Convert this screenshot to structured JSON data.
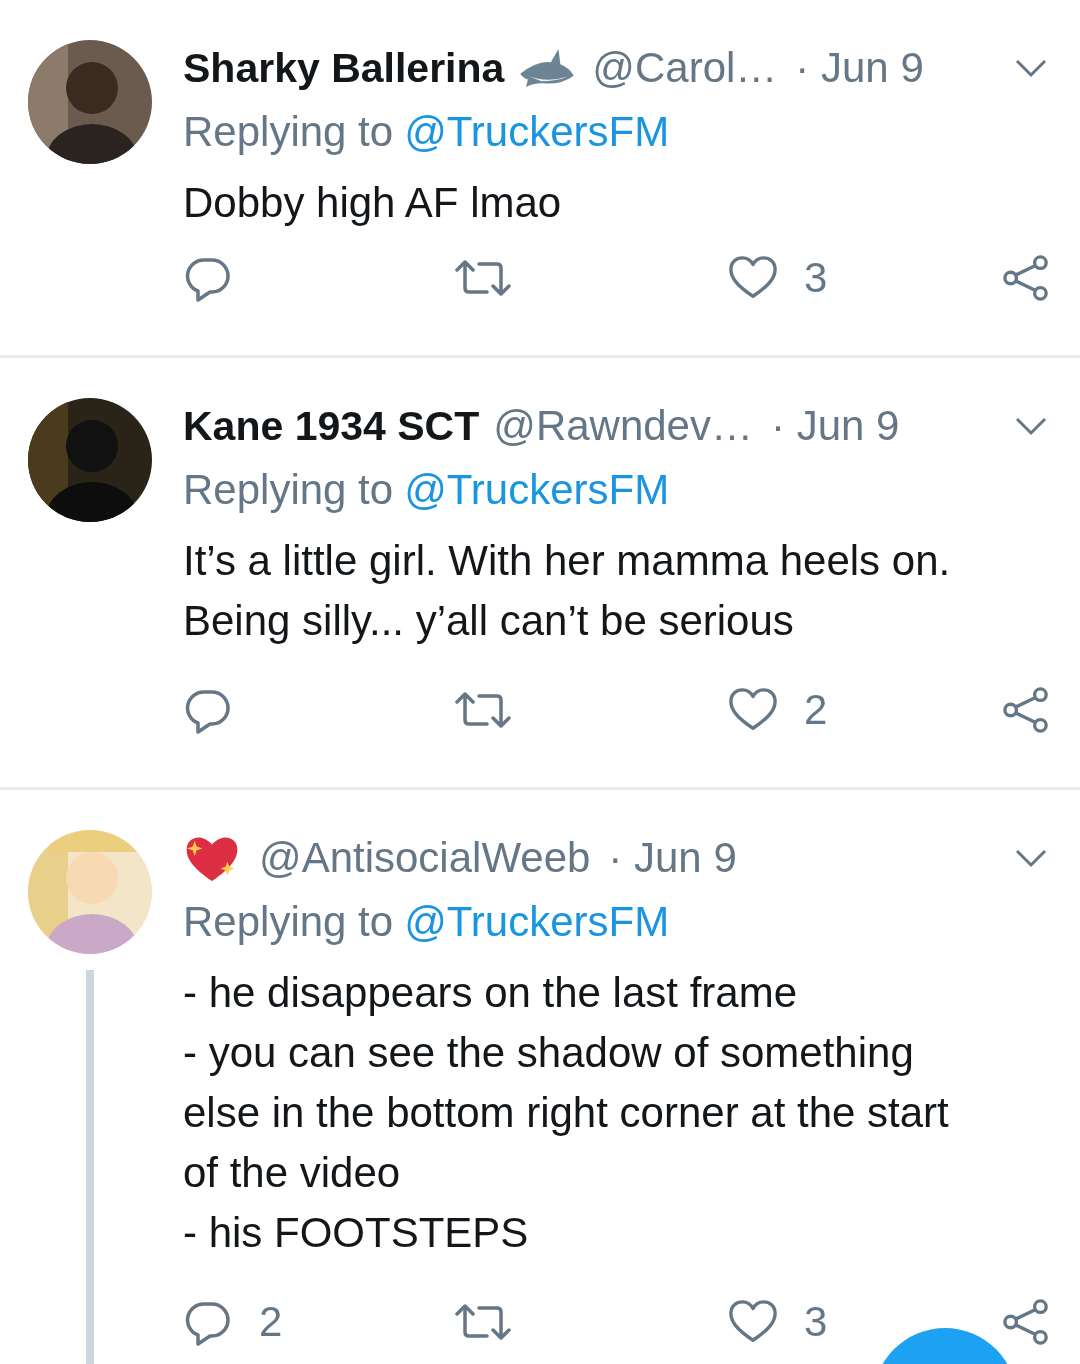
{
  "tweets": [
    {
      "name": "Sharky Ballerina",
      "badge": {
        "kind": "shark"
      },
      "handle": "@Carol…",
      "date": "· Jun 9",
      "reply_label": "Replying to",
      "reply_to": "@TruckersFM",
      "text": "Dobby high AF lmao",
      "likes": "3",
      "thread": false
    },
    {
      "name": "Kane 1934 SCT",
      "handle": "@Rawndev…",
      "date": "· Jun 9",
      "reply_label": "Replying to",
      "reply_to": "@TruckersFM",
      "text": "It’s a little girl. With her mamma heels on.\nBeing silly... y’all can’t be serious",
      "likes": "2",
      "thread": false
    },
    {
      "badge": {
        "kind": "heart"
      },
      "handle": "@AntisocialWeeb",
      "date": "· Jun 9",
      "reply_label": "Replying to",
      "reply_to": "@TruckersFM",
      "text": "- he disappears on the last frame\n- you can see the shadow of something\nelse in the bottom right corner at the start\nof the video\n- his FOOTSTEPS",
      "replies": "2",
      "likes": "3",
      "thread": true
    }
  ]
}
